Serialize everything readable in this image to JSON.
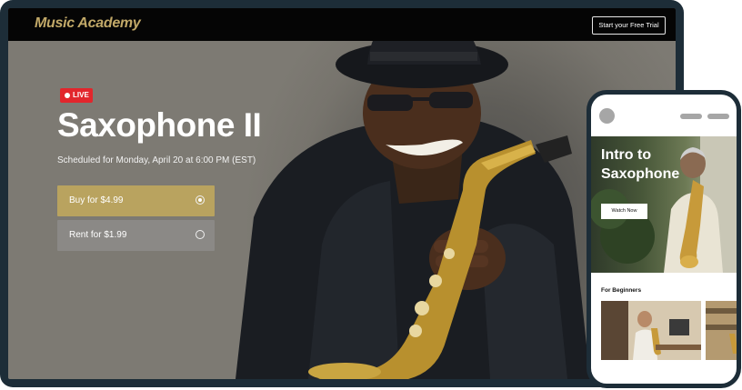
{
  "desktop": {
    "header": {
      "brand": "Music Academy",
      "trial_button": "Start your Free Trial"
    },
    "hero": {
      "badge": "LIVE",
      "title": "Saxophone II",
      "schedule": "Scheduled for Monday, April 20 at 6:00 PM (EST)",
      "options": [
        {
          "label": "Buy for $4.99",
          "selected": true
        },
        {
          "label": "Rent for $1.99",
          "selected": false
        }
      ]
    }
  },
  "mobile": {
    "hero": {
      "title": "Intro to Saxophone",
      "watch_button": "Watch Now"
    },
    "section_title": "For Beginners"
  },
  "colors": {
    "brand_gold": "#c2a968",
    "buy_option": "#b9a35f",
    "rent_option": "#8b8986",
    "live_red": "#e2262c",
    "frame": "#1d2d38"
  }
}
